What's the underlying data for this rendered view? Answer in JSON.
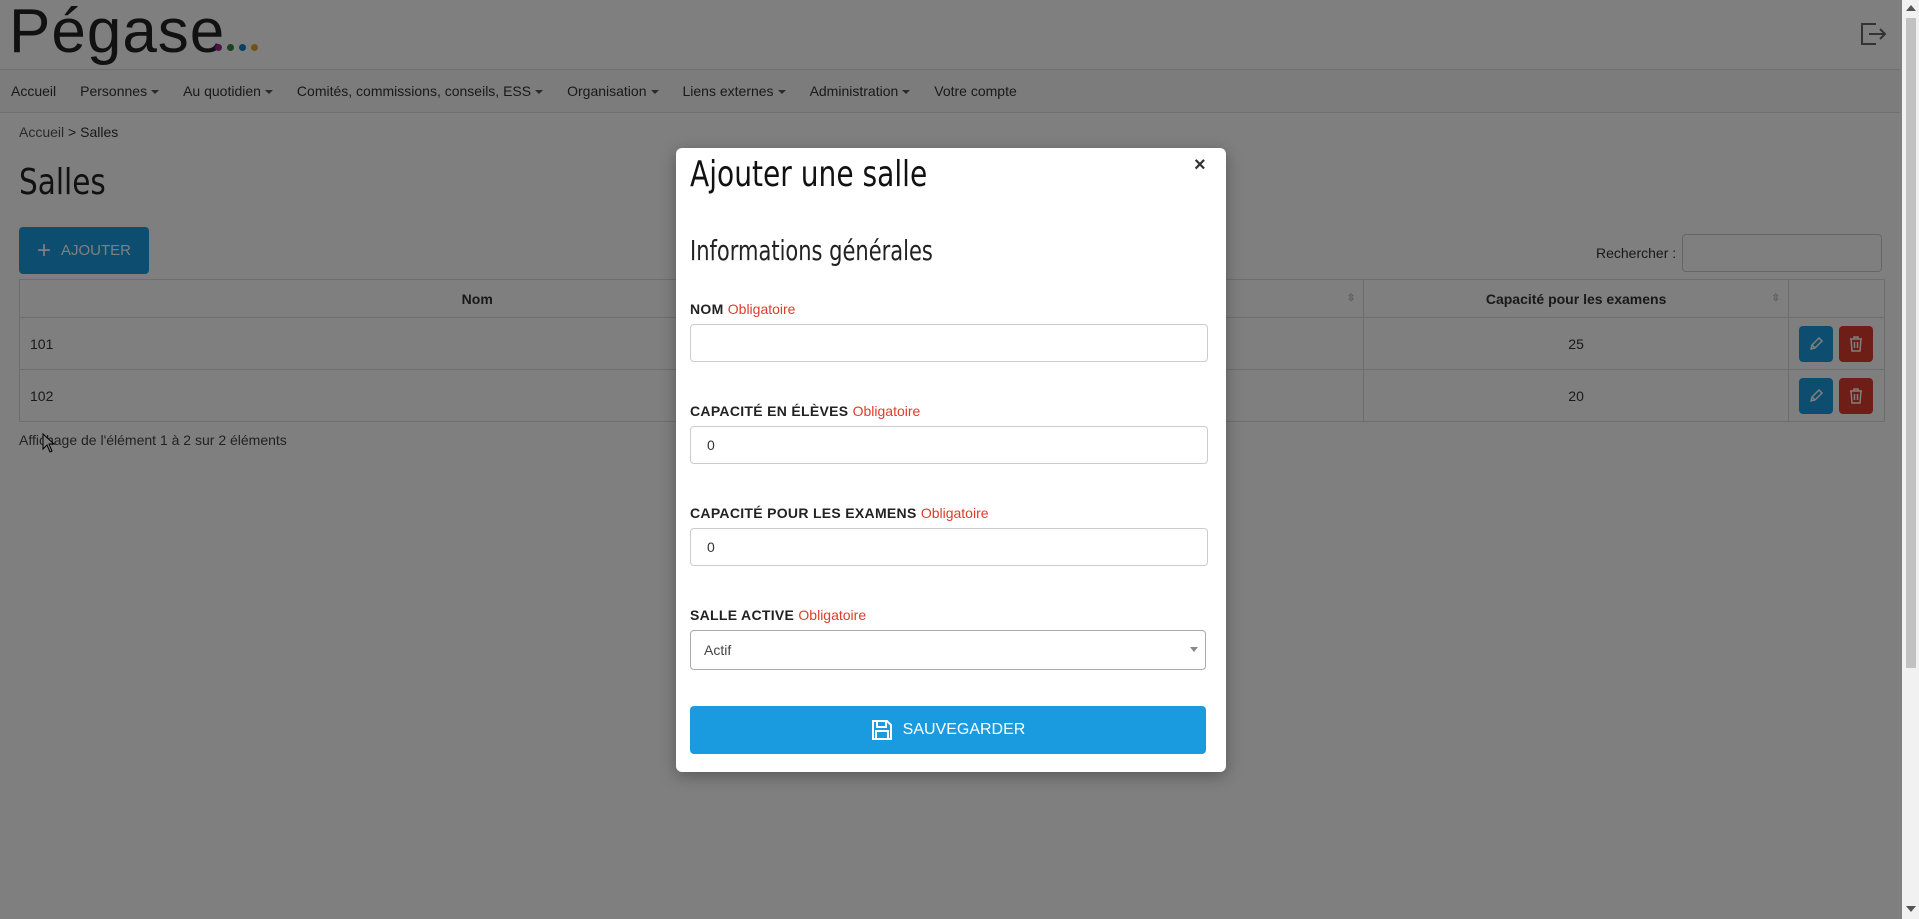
{
  "header": {
    "logo_text": "Pégase",
    "logo_dots": [
      "#8e2b8e",
      "#2d8b3a",
      "#1a7fc1",
      "#e0a62a"
    ]
  },
  "nav": {
    "items": [
      {
        "label": "Accueil",
        "dropdown": false
      },
      {
        "label": "Personnes",
        "dropdown": true
      },
      {
        "label": "Au quotidien",
        "dropdown": true
      },
      {
        "label": "Comités, commissions, conseils, ESS",
        "dropdown": true
      },
      {
        "label": "Organisation",
        "dropdown": true
      },
      {
        "label": "Liens externes",
        "dropdown": true
      },
      {
        "label": "Administration",
        "dropdown": true
      },
      {
        "label": "Votre compte",
        "dropdown": false
      }
    ]
  },
  "breadcrumb": {
    "home": "Accueil",
    "separator": ">",
    "current": "Salles"
  },
  "page": {
    "title": "Salles",
    "add_label": "AJOUTER",
    "search_label": "Rechercher :"
  },
  "table": {
    "headers": {
      "nom": "Nom",
      "capacite_examens": "Capacité pour les examens"
    },
    "rows": [
      {
        "nom": "101",
        "capacite_examens": "25"
      },
      {
        "nom": "102",
        "capacite_examens": "20"
      }
    ],
    "info": "Affichage de l'élément 1 à 2 sur 2 éléments"
  },
  "modal": {
    "title": "Ajouter une salle",
    "close_symbol": "×",
    "section_title": "Informations générales",
    "required_label": "Obligatoire",
    "fields": {
      "nom": {
        "label": "NOM",
        "value": ""
      },
      "capacite_eleves": {
        "label": "CAPACITÉ EN ÉLÈVES",
        "value": "0"
      },
      "capacite_examens": {
        "label": "CAPACITÉ POUR LES EXAMENS",
        "value": "0"
      },
      "salle_active": {
        "label": "SALLE ACTIVE",
        "value": "Actif"
      }
    },
    "save_label": "SAUVEGARDER"
  },
  "colors": {
    "primary": "#1a9be0",
    "danger": "#dd3c2c"
  }
}
